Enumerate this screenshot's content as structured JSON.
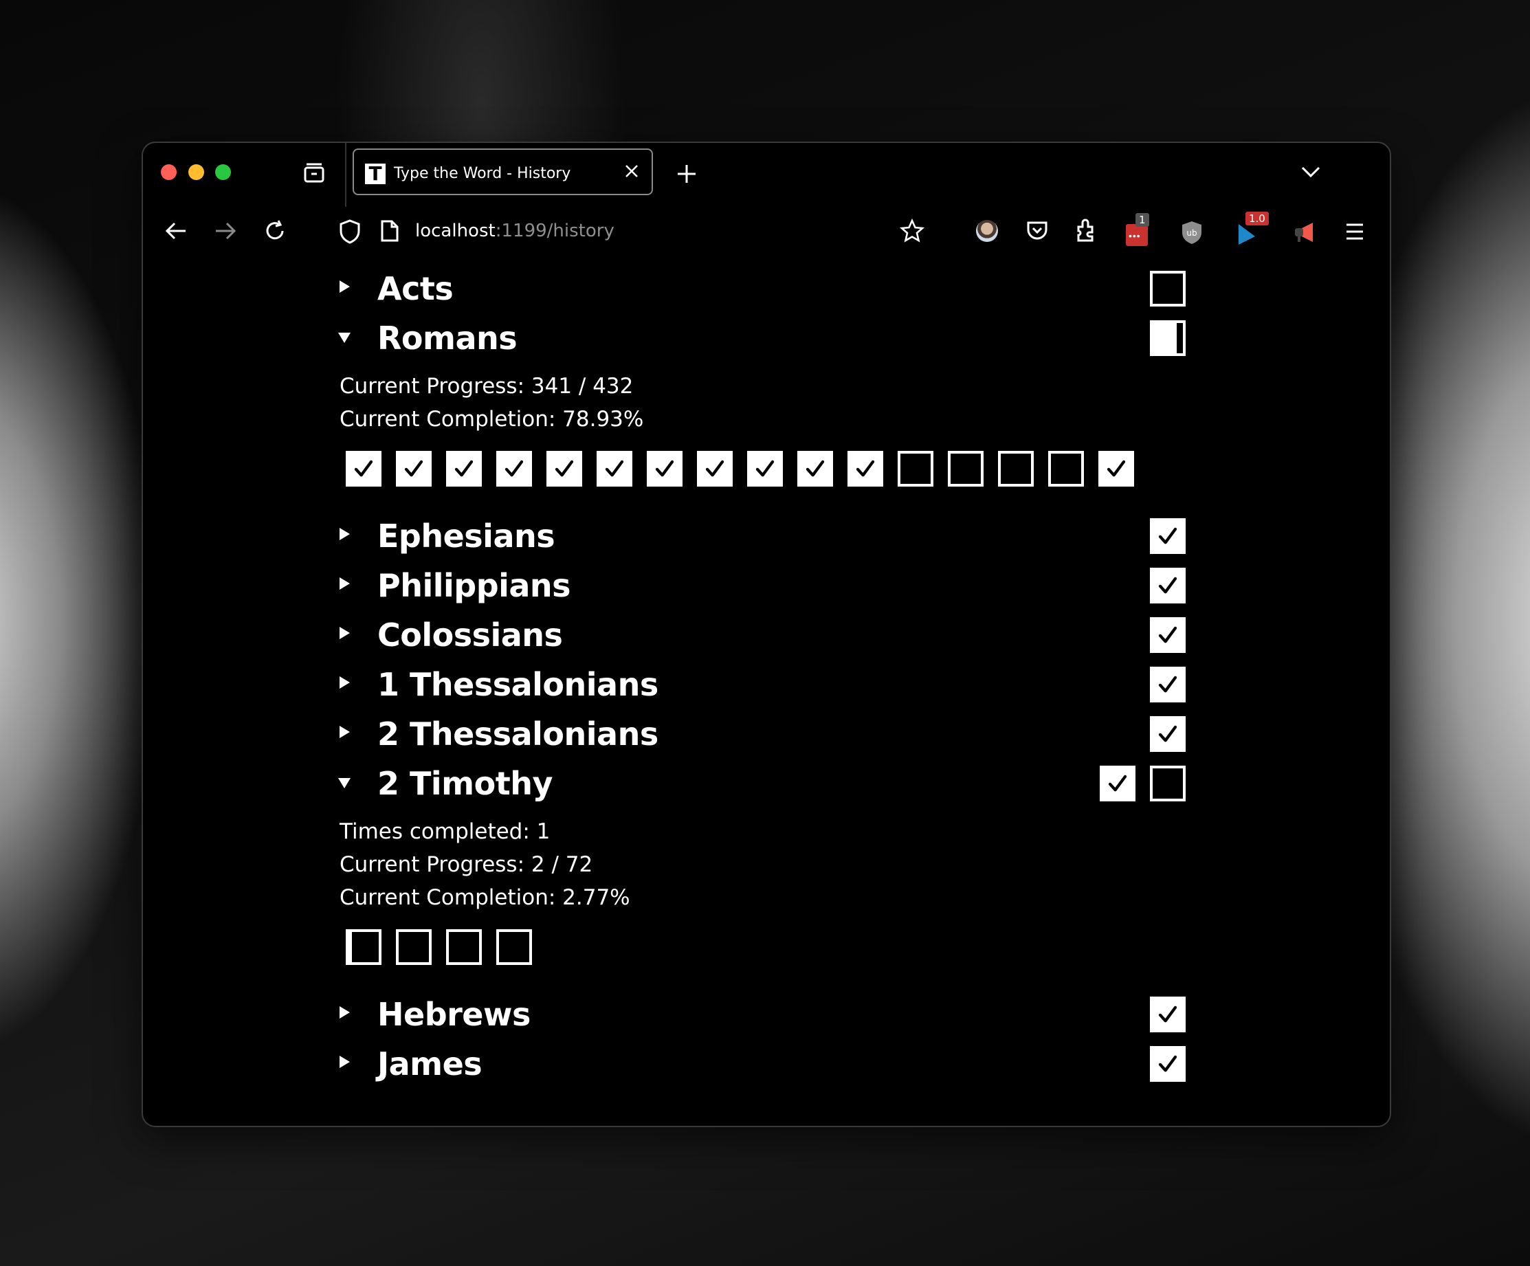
{
  "browser": {
    "tab": {
      "favicon_letter": "T",
      "title": "Type the Word - History"
    },
    "url": {
      "host": "localhost",
      "rest": ":1199/history"
    },
    "toolbar_icons": [
      "back-icon",
      "forward-icon",
      "reload-icon",
      "shield-icon",
      "page-icon",
      "bookmark-star-icon",
      "profile-avatar-icon",
      "pocket-icon",
      "extensions-puzzle-icon",
      "lastpass-icon",
      "ublock-icon",
      "extension-blue-flag-icon",
      "megaphone-icon",
      "menu-hamburger-icon"
    ],
    "badges": {
      "lastpass": "1",
      "blue_flag": "1.0"
    }
  },
  "books": [
    {
      "name": "Acts",
      "expanded": false,
      "boxes": [
        {
          "state": "empty"
        }
      ]
    },
    {
      "name": "Romans",
      "expanded": true,
      "boxes": [
        {
          "state": "partial",
          "fraction": 0.7893
        }
      ],
      "details": [
        "Current Progress: 341 / 432",
        "Current Completion: 78.93%"
      ],
      "chapters": [
        "checked",
        "checked",
        "checked",
        "checked",
        "checked",
        "checked",
        "checked",
        "checked",
        "checked",
        "checked",
        "checked",
        "empty",
        "empty",
        "empty",
        "empty",
        "checked"
      ]
    },
    {
      "name": "Ephesians",
      "expanded": false,
      "boxes": [
        {
          "state": "checked"
        }
      ]
    },
    {
      "name": "Philippians",
      "expanded": false,
      "boxes": [
        {
          "state": "checked"
        }
      ]
    },
    {
      "name": "Colossians",
      "expanded": false,
      "boxes": [
        {
          "state": "checked"
        }
      ]
    },
    {
      "name": "1 Thessalonians",
      "expanded": false,
      "boxes": [
        {
          "state": "checked"
        }
      ]
    },
    {
      "name": "2 Thessalonians",
      "expanded": false,
      "boxes": [
        {
          "state": "checked"
        }
      ]
    },
    {
      "name": "2 Timothy",
      "expanded": true,
      "boxes": [
        {
          "state": "checked"
        },
        {
          "state": "empty"
        }
      ],
      "details": [
        "Times completed: 1",
        "Current Progress: 2 / 72",
        "Current Completion: 2.77%"
      ],
      "chapters": [
        "partial-low",
        "empty",
        "empty",
        "empty"
      ]
    },
    {
      "name": "Hebrews",
      "expanded": false,
      "boxes": [
        {
          "state": "checked"
        }
      ]
    },
    {
      "name": "James",
      "expanded": false,
      "boxes": [
        {
          "state": "checked"
        }
      ]
    }
  ]
}
